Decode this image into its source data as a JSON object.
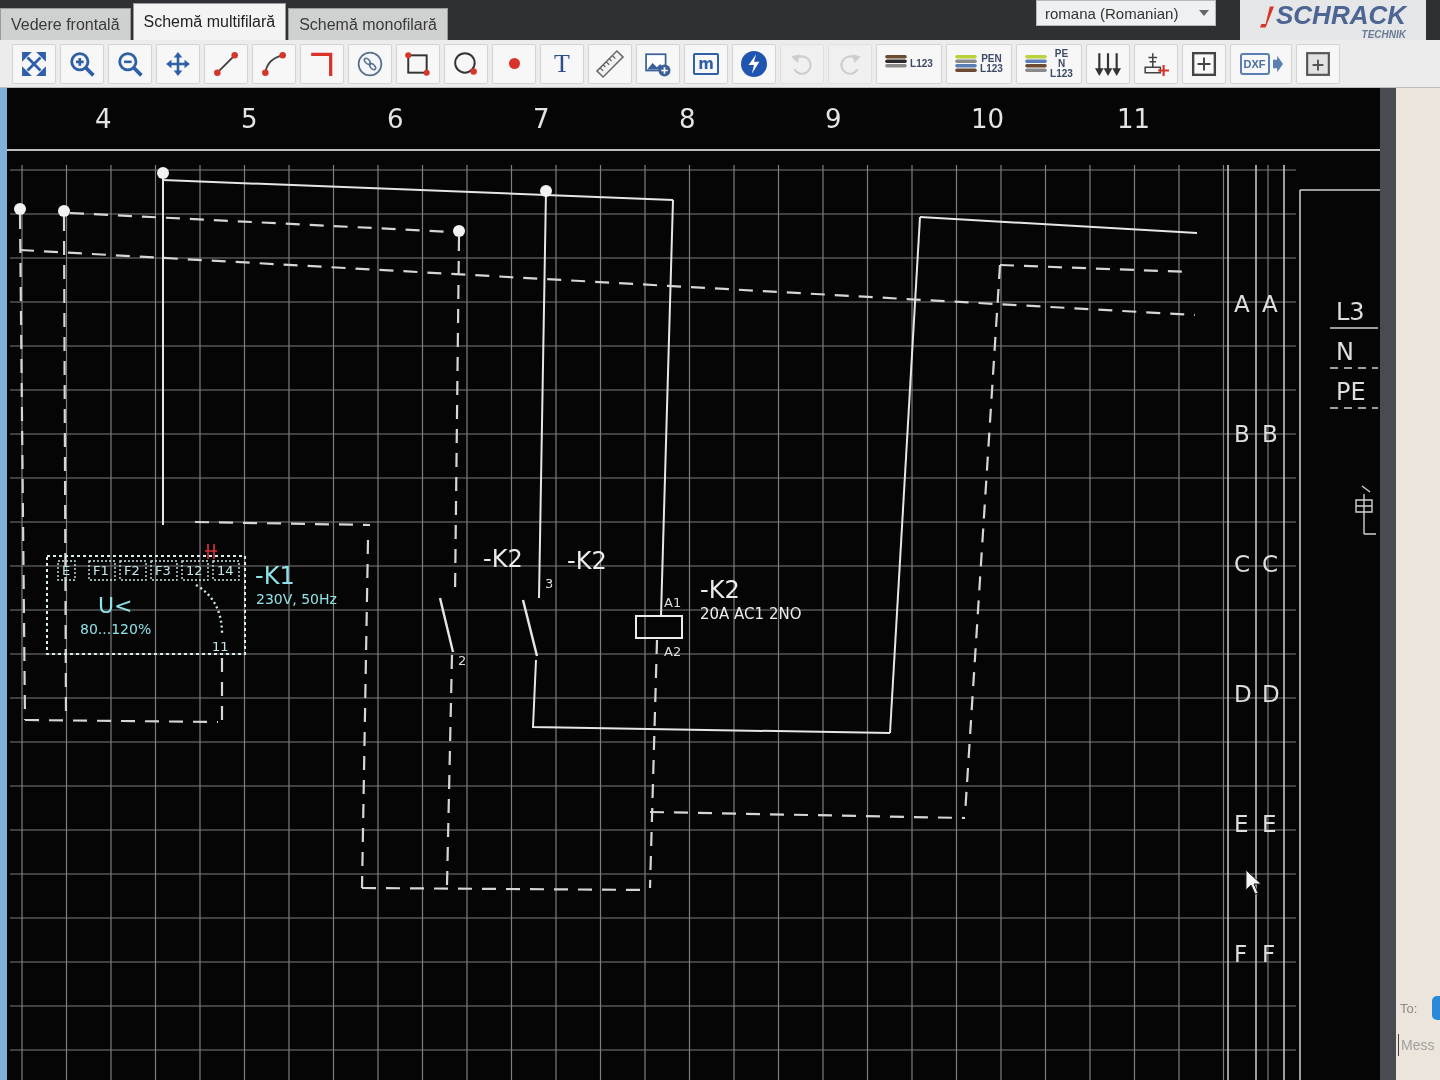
{
  "tabs": [
    {
      "label": "Vedere frontală",
      "selected": false
    },
    {
      "label": "Schemă multifilară",
      "selected": true
    },
    {
      "label": "Schemă monofilară",
      "selected": false
    }
  ],
  "language_select": {
    "value": "romana (Romanian)"
  },
  "logo": {
    "wordmark": "SCHRACK",
    "tagline": "TECHNIK"
  },
  "toolbar": [
    {
      "kind": "icon",
      "disabled": false
    },
    {
      "kind": "icon",
      "disabled": false
    },
    {
      "kind": "icon",
      "disabled": false
    },
    {
      "kind": "icon",
      "disabled": false
    },
    {
      "kind": "icon",
      "disabled": false
    },
    {
      "kind": "icon",
      "disabled": false
    },
    {
      "kind": "icon",
      "disabled": false
    },
    {
      "kind": "icon",
      "disabled": false
    },
    {
      "kind": "icon",
      "disabled": false
    },
    {
      "kind": "icon",
      "disabled": false
    },
    {
      "kind": "icon",
      "disabled": false
    },
    {
      "kind": "letter",
      "label": "T",
      "disabled": false
    },
    {
      "kind": "icon",
      "disabled": false
    },
    {
      "kind": "icon",
      "disabled": false
    },
    {
      "kind": "letter",
      "label": "m",
      "disabled": false
    },
    {
      "kind": "icon",
      "disabled": false
    },
    {
      "kind": "icon",
      "disabled": true
    },
    {
      "kind": "icon",
      "disabled": true
    },
    {
      "kind": "wire-set",
      "lines": [
        "L123"
      ],
      "disabled": false
    },
    {
      "kind": "wire-set",
      "lines": [
        "PEN",
        "L123"
      ],
      "disabled": false
    },
    {
      "kind": "wire-set",
      "lines": [
        "PE",
        "N",
        "L123"
      ],
      "disabled": false
    },
    {
      "kind": "icon",
      "disabled": false
    },
    {
      "kind": "icon",
      "disabled": false
    },
    {
      "kind": "icon",
      "disabled": false
    },
    {
      "kind": "export",
      "label": "DXF",
      "disabled": false
    },
    {
      "kind": "icon",
      "disabled": false
    }
  ],
  "canvas": {
    "column_numbers": [
      "4",
      "5",
      "6",
      "7",
      "8",
      "9",
      "10",
      "11"
    ],
    "components": [
      {
        "kind": "monitoring-relay",
        "tag": "-K1",
        "rating": "230V, 50Hz",
        "symbol": "U<",
        "range": "80...120%",
        "terminals": [
          "E",
          "F1",
          "F2",
          "F3",
          "12",
          "14"
        ],
        "contact_terminal": "11"
      },
      {
        "kind": "contact",
        "tag": "-K2",
        "terminal": "2"
      },
      {
        "kind": "contact",
        "tag": "-K2",
        "terminal": "3"
      },
      {
        "kind": "coil",
        "tag": "-K2",
        "rating": "20A AC1 2NO",
        "terminals": [
          "A1",
          "A2"
        ]
      }
    ],
    "row_markers": [
      {
        "left": "A",
        "right": "A"
      },
      {
        "left": "B",
        "right": "B"
      },
      {
        "left": "C",
        "right": "C"
      },
      {
        "left": "D",
        "right": "D"
      },
      {
        "left": "E",
        "right": "E"
      },
      {
        "left": "F",
        "right": "F"
      }
    ],
    "bus_labels": [
      "L3",
      "N",
      "PE"
    ]
  },
  "message_panel": {
    "to_label": "To:",
    "message_placeholder": "Mess"
  }
}
